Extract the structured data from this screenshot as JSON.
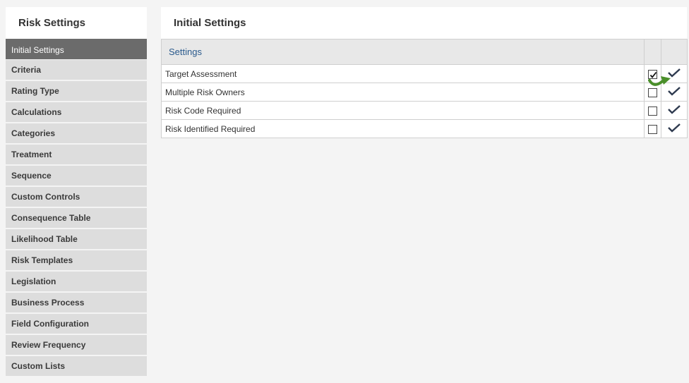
{
  "sidebar": {
    "title": "Risk Settings",
    "items": [
      {
        "label": "Initial Settings",
        "active": true
      },
      {
        "label": "Criteria"
      },
      {
        "label": "Rating Type"
      },
      {
        "label": "Calculations"
      },
      {
        "label": "Categories"
      },
      {
        "label": "Treatment"
      },
      {
        "label": "Sequence"
      },
      {
        "label": "Custom Controls"
      },
      {
        "label": "Consequence Table"
      },
      {
        "label": "Likelihood Table"
      },
      {
        "label": "Risk Templates"
      },
      {
        "label": "Legislation"
      },
      {
        "label": "Business Process"
      },
      {
        "label": "Field Configuration"
      },
      {
        "label": "Review Frequency"
      },
      {
        "label": "Custom Lists"
      }
    ]
  },
  "main": {
    "title": "Initial Settings",
    "table": {
      "header": "Settings",
      "rows": [
        {
          "label": "Target Assessment",
          "checked": true
        },
        {
          "label": "Multiple Risk Owners",
          "checked": false
        },
        {
          "label": "Risk Code Required",
          "checked": false
        },
        {
          "label": "Risk Identified Required",
          "checked": false
        }
      ]
    }
  },
  "colors": {
    "tick": "#2e3a4f",
    "cursor": "#4a8f2a",
    "header_text": "#2a5a8c",
    "active_nav": "#6b6b6b"
  }
}
